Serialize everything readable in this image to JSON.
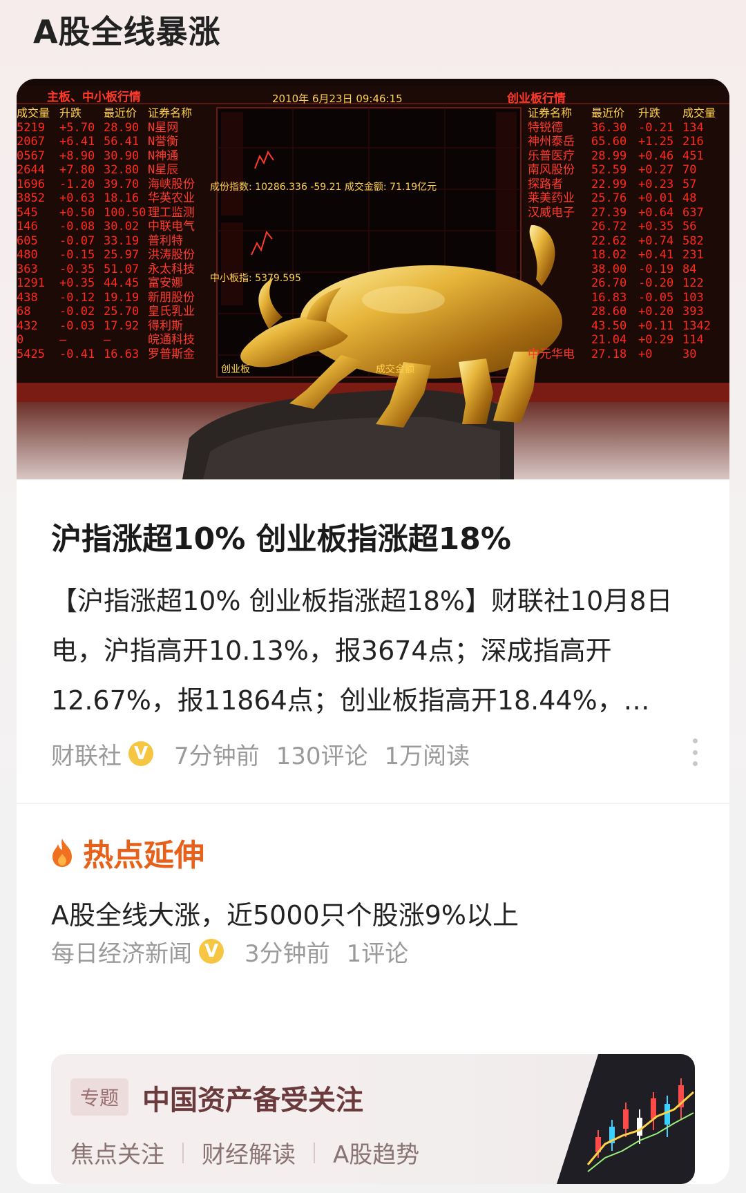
{
  "page": {
    "heading": "A股全线暴涨"
  },
  "hero_board": {
    "left_title": "主板、中小板行情",
    "date_time": "2010年 6月23日   09:46:15",
    "right_title": "创业板行情",
    "left_headers": [
      "成交量",
      "升跌",
      "最近价",
      "证券名称"
    ],
    "left_rows": [
      [
        "5219",
        "+5.70",
        "28.90",
        "N星网"
      ],
      [
        "2067",
        "+6.41",
        "56.41",
        "N誉衡"
      ],
      [
        "0567",
        "+8.90",
        "30.90",
        "N神通"
      ],
      [
        "2644",
        "+7.80",
        "32.80",
        "N星辰"
      ],
      [
        "1696",
        "-1.20",
        "39.70",
        "海峡股份"
      ],
      [
        "3852",
        "+0.63",
        "18.16",
        "华英农业"
      ],
      [
        "545",
        "+0.50",
        "100.50",
        "理工监测"
      ],
      [
        "146",
        "-0.08",
        "30.02",
        "中联电气"
      ],
      [
        "605",
        "-0.07",
        "33.19",
        "普利特"
      ],
      [
        "480",
        "-0.15",
        "25.97",
        "洪涛股份"
      ],
      [
        "363",
        "-0.35",
        "51.07",
        "永太科技"
      ],
      [
        "1291",
        "+0.35",
        "44.45",
        "富安娜"
      ],
      [
        "438",
        "-0.12",
        "19.19",
        "新朋股份"
      ],
      [
        "68",
        "-0.02",
        "25.70",
        "皇氏乳业"
      ],
      [
        "432",
        "-0.03",
        "17.92",
        "得利斯"
      ],
      [
        "0",
        "—",
        "—",
        "皖通科技"
      ],
      [
        "5425",
        "-0.41",
        "16.63",
        "罗普斯金"
      ]
    ],
    "right_headers": [
      "证券名称",
      "最近价",
      "升跌",
      "成交量"
    ],
    "right_rows": [
      [
        "特锐德",
        "36.30",
        "-0.21",
        "134"
      ],
      [
        "神州泰岳",
        "65.60",
        "+1.25",
        "216"
      ],
      [
        "乐普医疗",
        "28.99",
        "+0.46",
        "451"
      ],
      [
        "南风股份",
        "52.59",
        "+0.27",
        "70"
      ],
      [
        "探路者",
        "22.99",
        "+0.23",
        "57"
      ],
      [
        "莱美药业",
        "25.76",
        "+0.01",
        "48"
      ],
      [
        "汉威电子",
        "27.39",
        "+0.64",
        "637"
      ],
      [
        "",
        "26.72",
        "+0.35",
        "56"
      ],
      [
        "",
        "22.62",
        "+0.74",
        "582"
      ],
      [
        "",
        "18.02",
        "+0.41",
        "231"
      ],
      [
        "",
        "38.00",
        "-0.19",
        "84"
      ],
      [
        "",
        "26.70",
        "-0.20",
        "122"
      ],
      [
        "",
        "16.83",
        "-0.05",
        "103"
      ],
      [
        "",
        "28.60",
        "+0.20",
        "393"
      ],
      [
        "",
        "43.50",
        "+0.11",
        "1342"
      ],
      [
        "",
        "21.04",
        "+0.29",
        "114"
      ],
      [
        "中元华电",
        "27.18",
        "+0",
        "30"
      ]
    ],
    "index_line": "成份指数: 10286.336   -59.21   成交金额:   71.19亿元",
    "small_board": "中小板指: 5379.595",
    "cyb_label": "创业板",
    "turnover_label": "成交金额"
  },
  "article": {
    "headline": "沪指涨超10% 创业板指涨超18%",
    "summary": "【沪指涨超10% 创业板指涨超18%】财联社10月8日电，沪指高开10.13%，报3674点；深成指高开12.67%，报11864点；创业板指高开18.44%，…",
    "source": "财联社",
    "verified_mark": "V",
    "time": "7分钟前",
    "comments": "130评论",
    "reads": "1万阅读"
  },
  "hot_extension": {
    "title": "热点延伸",
    "item_title": "A股全线大涨，近5000只个股涨9%以上",
    "source": "每日经济新闻",
    "verified_mark": "V",
    "time": "3分钟前",
    "comments": "1评论"
  },
  "topic": {
    "tag": "专题",
    "title": "中国资产备受关注",
    "links": [
      "焦点关注",
      "财经解读",
      "A股趋势"
    ]
  },
  "colors": {
    "hot_orange": "#e8611a",
    "verified_gold": "#f6c643",
    "board_red": "#ff2a1a",
    "board_amber": "#ffd24a",
    "topic_title": "#6b3a3c"
  }
}
